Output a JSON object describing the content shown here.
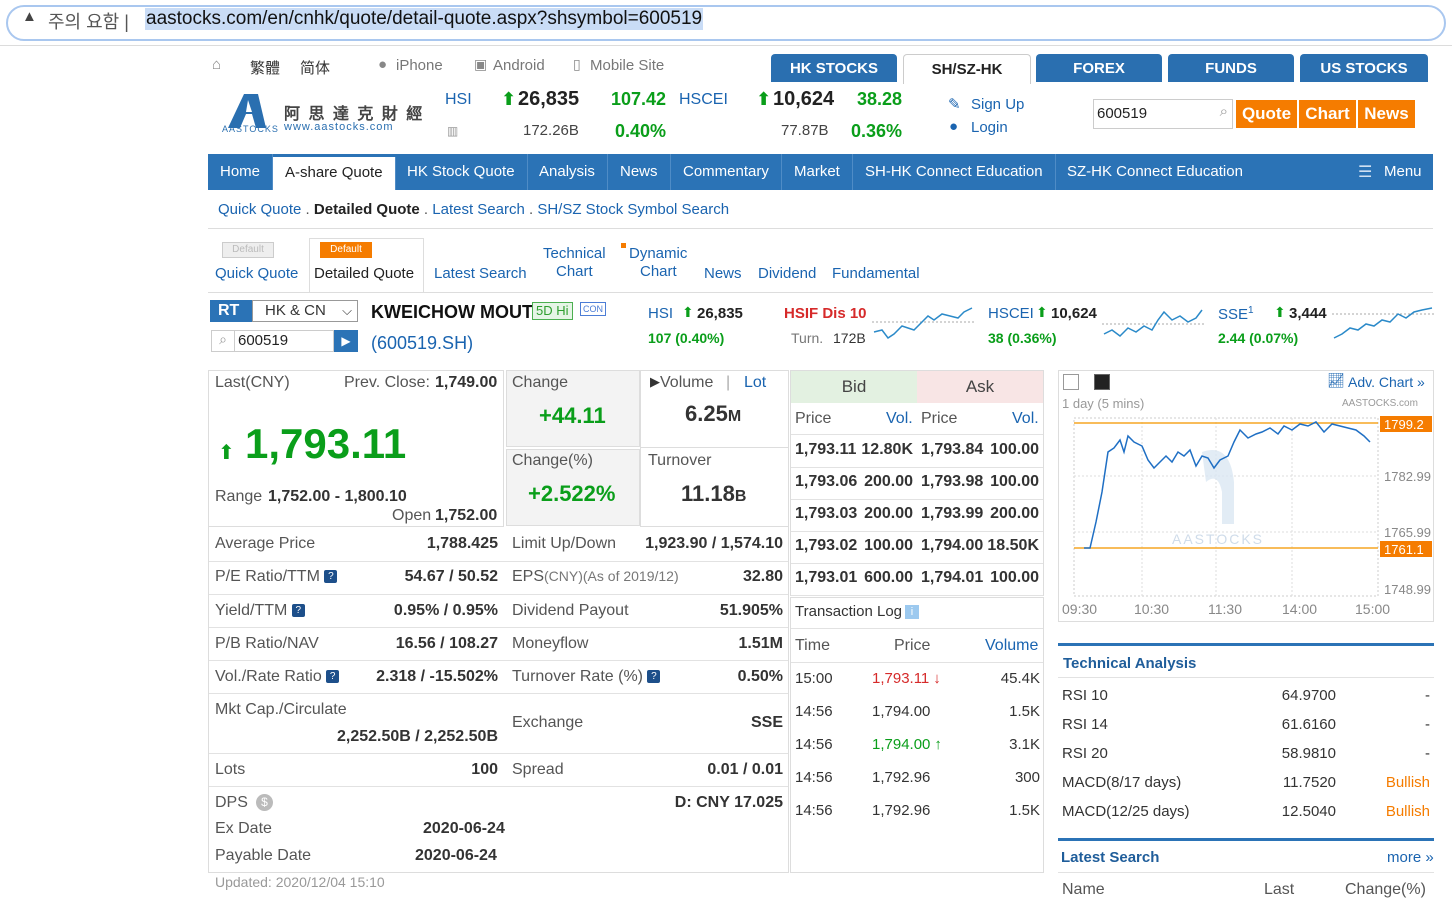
{
  "browser": {
    "warning_icon": "warning-triangle-icon",
    "warning_text": "주의 요함 |",
    "url": "aastocks.com/en/cnhk/quote/detail-quote.aspx?shsymbol=600519"
  },
  "toplinks": {
    "traditional": "繁體",
    "simplified": "简体",
    "iphone": "iPhone",
    "android": "Android",
    "mobile": "Mobile Site"
  },
  "market_tabs": [
    "HK STOCKS",
    "SH/SZ-HK",
    "FOREX",
    "FUNDS",
    "US STOCKS"
  ],
  "logo": {
    "cn": "阿 思 達 克 財 經",
    "url": "www.aastocks.com",
    "mark": "AASTOCKS"
  },
  "indices_header": {
    "hsi_label": "HSI",
    "hsi_value": "26,835",
    "hsi_change": "107.42",
    "hsi_turnover": "172.26B",
    "hsi_pct": "0.40%",
    "hscei_label": "HSCEI",
    "hscei_value": "10,624",
    "hscei_change": "38.28",
    "hscei_turnover": "77.87B",
    "hscei_pct": "0.36%"
  },
  "account": {
    "signup": "Sign Up",
    "login": "Login"
  },
  "search": {
    "value": "600519",
    "quote": "Quote",
    "chart": "Chart",
    "news": "News"
  },
  "nav": [
    "Home",
    "A-share Quote",
    "HK Stock Quote",
    "Analysis",
    "News",
    "Commentary",
    "Market",
    "SH-HK Connect Education",
    "SZ-HK Connect Education",
    "Menu"
  ],
  "subnav": {
    "quick": "Quick Quote",
    "detailed": "Detailed Quote",
    "latest": "Latest Search",
    "symbol": "SH/SZ Stock Symbol Search"
  },
  "page_tabs": {
    "default_badge": "Default",
    "quick": "Quick Quote",
    "detailed": "Detailed Quote",
    "latest": "Latest Search",
    "tech_1": "Technical",
    "tech_2": "Chart",
    "dyn_1": "Dynamic",
    "dyn_2": "Chart",
    "news": "News",
    "dividend": "Dividend",
    "fundamental": "Fundamental"
  },
  "quote_bar": {
    "rt": "RT",
    "market_select": "HK & CN",
    "symbol_input": "600519",
    "name": "KWEICHOW MOUT",
    "badge_5d": "5D Hi",
    "badge_con": "CON",
    "code": "(600519.SH)",
    "hsi_label": "HSI",
    "hsi_value": "26,835",
    "hsi_change": "107 (0.40%)",
    "hsif_label": "HSIF Dis 10",
    "turn_label": "Turn.",
    "turn_value": "172B",
    "hscei_label": "HSCEI",
    "hscei_value": "10,624",
    "hscei_change": "38 (0.36%)",
    "sse_label": "SSE",
    "sse_sup": "1",
    "sse_value": "3,444",
    "sse_change": "2.44 (0.07%)"
  },
  "last": {
    "label": "Last(CNY)",
    "prev_label": "Prev. Close:",
    "prev_value": "1,749.00",
    "price": "1,793.11",
    "range_label": "Range",
    "range_value": "1,752.00 - 1,800.10",
    "open_label": "Open",
    "open_value": "1,752.00"
  },
  "change": {
    "label": "Change",
    "value": "+44.11",
    "pct_label": "Change(%)",
    "pct_value": "+2.522%"
  },
  "volume": {
    "label": "Volume",
    "lot_label": "Lot",
    "value": "6.25",
    "unit": "M",
    "turnover_label": "Turnover",
    "turnover_value": "11.18",
    "turnover_unit": "B"
  },
  "stats_left": [
    {
      "label": "Average Price",
      "value": "1,788.425"
    },
    {
      "label": "P/E Ratio/TTM",
      "value": "54.67 / 50.52"
    },
    {
      "label": "Yield/TTM",
      "value": "0.95% / 0.95%"
    },
    {
      "label": "P/B Ratio/NAV",
      "value": "16.56 / 108.27"
    },
    {
      "label": "Vol./Rate Ratio",
      "value": "2.318 / -15.502%"
    }
  ],
  "stats_right": [
    {
      "label": "Limit Up/Down",
      "value": "1,923.90 / 1,574.10"
    },
    {
      "label": "EPS",
      "label_sub": "(CNY)(As of 2019/12)",
      "value": "32.80"
    },
    {
      "label": "Dividend Payout",
      "value": "51.905%"
    },
    {
      "label": "Moneyflow",
      "value": "1.51M"
    },
    {
      "label": "Turnover Rate (%)",
      "value": "0.50%"
    }
  ],
  "mktcap": {
    "label": "Mkt Cap./Circulate",
    "value": "2,252.50B / 2,252.50B",
    "exchange_label": "Exchange",
    "exchange_value": "SSE"
  },
  "lots": {
    "label": "Lots",
    "value": "100",
    "spread_label": "Spread",
    "spread_value": "0.01 / 0.01"
  },
  "dividend": {
    "dps_label": "DPS",
    "dps_value": "D: CNY 17.025",
    "ex_label": "Ex Date",
    "ex_value": "2020-06-24",
    "pay_label": "Payable Date",
    "pay_value": "2020-06-24"
  },
  "updated": "Updated: 2020/12/04 15:10",
  "orderbook": {
    "bid": "Bid",
    "ask": "Ask",
    "price": "Price",
    "vol": "Vol.",
    "rows": [
      [
        "1,793.11",
        "12.80K",
        "1,793.84",
        "100.00"
      ],
      [
        "1,793.06",
        "200.00",
        "1,793.98",
        "100.00"
      ],
      [
        "1,793.03",
        "200.00",
        "1,793.99",
        "200.00"
      ],
      [
        "1,793.02",
        "100.00",
        "1,794.00",
        "18.50K"
      ],
      [
        "1,793.01",
        "600.00",
        "1,794.01",
        "100.00"
      ]
    ]
  },
  "txlog": {
    "title": "Transaction Log",
    "time": "Time",
    "price": "Price",
    "volume": "Volume",
    "rows": [
      {
        "time": "15:00",
        "price": "1,793.11",
        "arrow": "↓",
        "vol": "45.4K",
        "color": "#d62a2a"
      },
      {
        "time": "14:56",
        "price": "1,794.00",
        "arrow": "",
        "vol": "1.5K",
        "color": "#333333"
      },
      {
        "time": "14:56",
        "price": "1,794.00",
        "arrow": "↑",
        "vol": "3.1K",
        "color": "#0a9e1a"
      },
      {
        "time": "14:56",
        "price": "1,792.96",
        "arrow": "",
        "vol": "300",
        "color": "#333333"
      },
      {
        "time": "14:56",
        "price": "1,792.96",
        "arrow": "",
        "vol": "1.5K",
        "color": "#333333"
      }
    ]
  },
  "minichart": {
    "adv": "Adv. Chart »",
    "period": "1 day (5 mins)",
    "brand": "AASTOCKS.com",
    "watermark": "AASTOCKS",
    "hi_label": "1799.2",
    "lo_label": "1761.1",
    "y_labels": [
      "1782.99",
      "1765.99",
      "1748.99"
    ],
    "x_labels": [
      "09:30",
      "10:30",
      "11:30",
      "14:00",
      "15:00"
    ]
  },
  "technical": {
    "title": "Technical Analysis",
    "rows": [
      {
        "name": "RSI 10",
        "value": "64.9700",
        "signal": "-"
      },
      {
        "name": "RSI 14",
        "value": "61.6160",
        "signal": "-"
      },
      {
        "name": "RSI 20",
        "value": "58.9810",
        "signal": "-"
      },
      {
        "name": "MACD(8/17 days)",
        "value": "11.7520",
        "signal": "Bullish"
      },
      {
        "name": "MACD(12/25 days)",
        "value": "12.5040",
        "signal": "Bullish"
      }
    ]
  },
  "latest_search": {
    "title": "Latest Search",
    "more": "more »",
    "name": "Name",
    "last": "Last",
    "change": "Change(%)"
  },
  "colors": {
    "brand_blue": "#2b73b6",
    "up_green": "#0a9e1a",
    "down_red": "#d62a2a",
    "orange": "#f57c00"
  }
}
